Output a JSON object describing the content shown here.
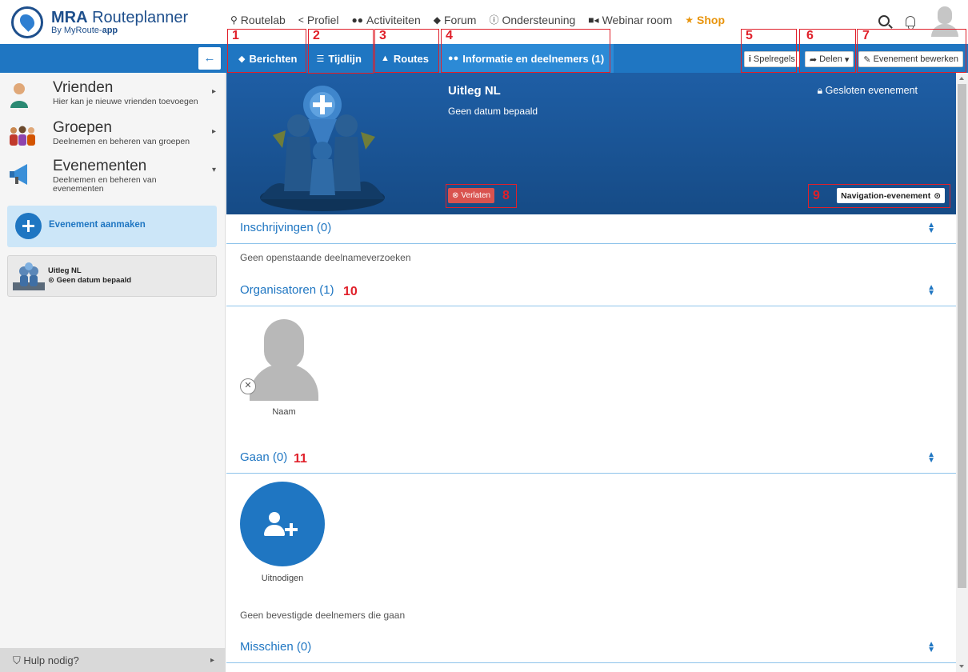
{
  "brand": {
    "title_bold": "MRA",
    "title_rest": "Routeplanner",
    "sub_pre": "By MyRoute-",
    "sub_bold": "app"
  },
  "mainnav": [
    {
      "label": "Routelab",
      "icon": "map-marker-icon"
    },
    {
      "label": "Profiel",
      "icon": "share-icon"
    },
    {
      "label": "Activiteiten",
      "icon": "users-icon"
    },
    {
      "label": "Forum",
      "icon": "comments-icon"
    },
    {
      "label": "Ondersteuning",
      "icon": "info-icon"
    },
    {
      "label": "Webinar room",
      "icon": "video-camera-icon"
    },
    {
      "label": "Shop",
      "icon": "star-icon"
    }
  ],
  "tabs": [
    {
      "label": "Berichten",
      "icon": "comments-icon"
    },
    {
      "label": "Tijdlijn",
      "icon": "list-icon"
    },
    {
      "label": "Routes",
      "icon": "road-icon"
    },
    {
      "label": "Informatie en deelnemers (1)",
      "icon": "users-icon",
      "active": true
    }
  ],
  "actions": {
    "rules": "Spelregels",
    "share": "Delen",
    "edit": "Evenement bewerken"
  },
  "sidebar": {
    "items": [
      {
        "title": "Vrienden",
        "subtitle": "Hier kan je nieuwe vrienden toevoegen"
      },
      {
        "title": "Groepen",
        "subtitle": "Deelnemen en beheren van groepen"
      },
      {
        "title": "Evenementen",
        "subtitle": "Deelnemen en beheren van evenementen"
      }
    ],
    "create_label": "Evenement aanmaken",
    "event_card": {
      "title": "Uitleg NL",
      "date": "Geen datum bepaald"
    },
    "help_label": "Hulp nodig?"
  },
  "event": {
    "title": "Uitleg NL",
    "date": "Geen datum bepaald",
    "closed": "Gesloten evenement",
    "leave": "Verlaten",
    "tag": "Navigation-evenement"
  },
  "sections": {
    "inschrijvingen": {
      "title": "Inschrijvingen (0)",
      "note": "Geen openstaande deelnameverzoeken"
    },
    "organisatoren": {
      "title": "Organisatoren (1)",
      "member_name": "Naam"
    },
    "gaan": {
      "title": "Gaan (0)",
      "invite_label": "Uitnodigen",
      "note": "Geen bevestigde deelnemers die gaan"
    },
    "misschien": {
      "title": "Misschien (0)"
    }
  },
  "annotations": [
    "1",
    "2",
    "3",
    "4",
    "5",
    "6",
    "7",
    "8",
    "9",
    "10",
    "11"
  ],
  "colors": {
    "primary": "#1f76c2",
    "accent_shop": "#e8940c",
    "danger": "#d9534f",
    "annotation": "#e0202a"
  }
}
